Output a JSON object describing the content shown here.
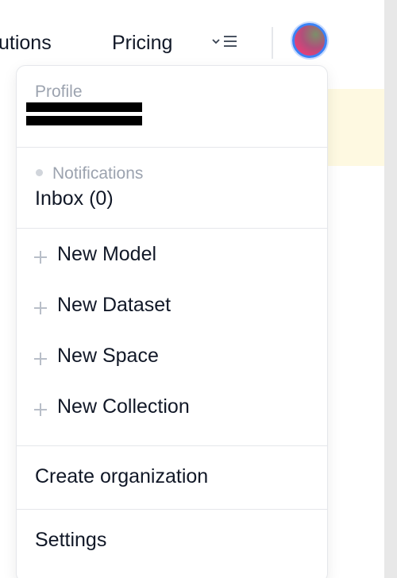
{
  "nav": {
    "solutions": "utions",
    "pricing": "Pricing",
    "more_icon": "chevron-down-menu-icon"
  },
  "dropdown": {
    "profile_label": "Profile",
    "notifications_label": "Notifications",
    "inbox_label": "Inbox (0)",
    "new_items": [
      {
        "label": "New Model",
        "icon": "plus-icon"
      },
      {
        "label": "New Dataset",
        "icon": "plus-icon"
      },
      {
        "label": "New Space",
        "icon": "plus-icon"
      },
      {
        "label": "New Collection",
        "icon": "plus-icon"
      }
    ],
    "create_org": "Create organization",
    "settings": "Settings"
  },
  "colors": {
    "accent_ring": "#3b82f6",
    "banner": "#fef9e1",
    "muted_text": "#9ca3af"
  }
}
